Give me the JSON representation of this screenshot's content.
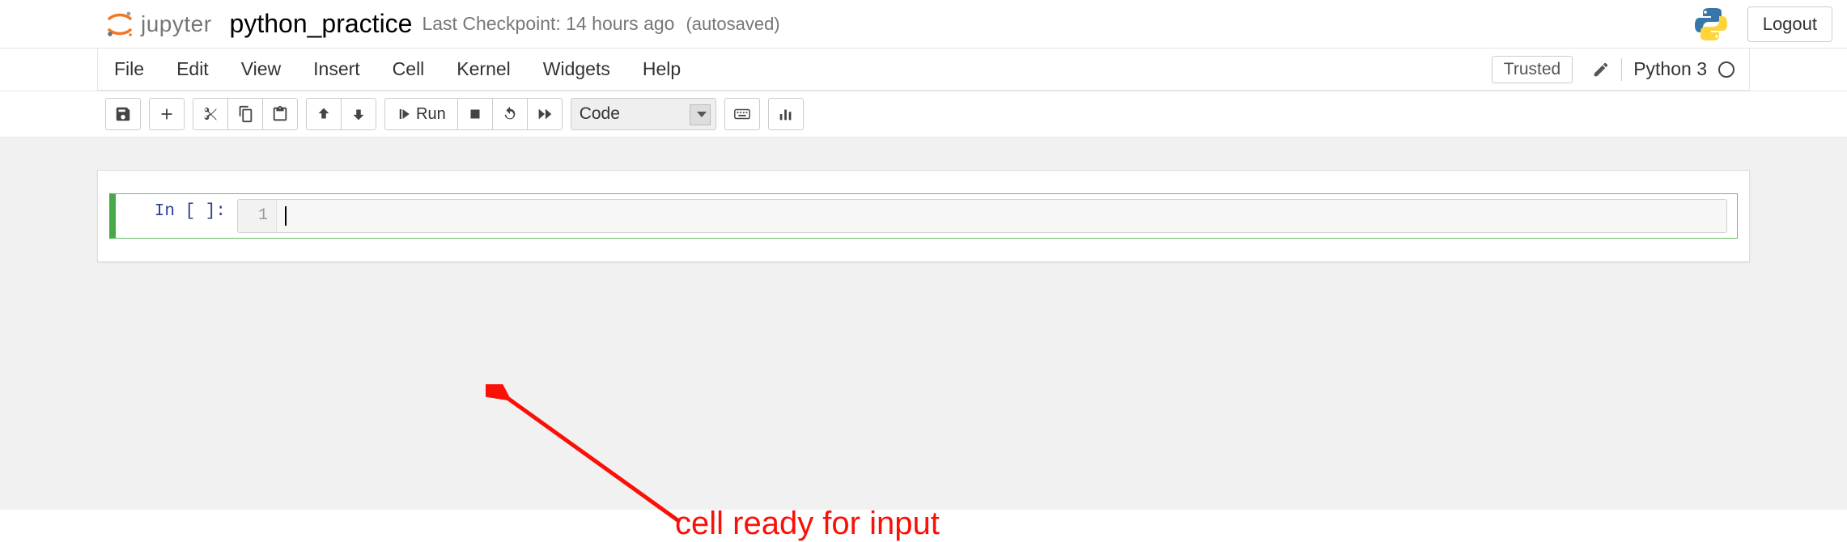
{
  "header": {
    "logo_text": "jupyter",
    "notebook_name": "python_practice",
    "checkpoint_text": "Last Checkpoint: 14 hours ago",
    "autosaved_text": "(autosaved)",
    "logout_label": "Logout"
  },
  "menubar": {
    "items": [
      "File",
      "Edit",
      "View",
      "Insert",
      "Cell",
      "Kernel",
      "Widgets",
      "Help"
    ],
    "trusted_label": "Trusted",
    "kernel_label": "Python 3"
  },
  "toolbar": {
    "run_label": "Run",
    "cell_type_value": "Code"
  },
  "cell": {
    "prompt": "In [ ]:",
    "line_number": "1",
    "content": ""
  },
  "annotation": {
    "label": "cell ready for input"
  }
}
